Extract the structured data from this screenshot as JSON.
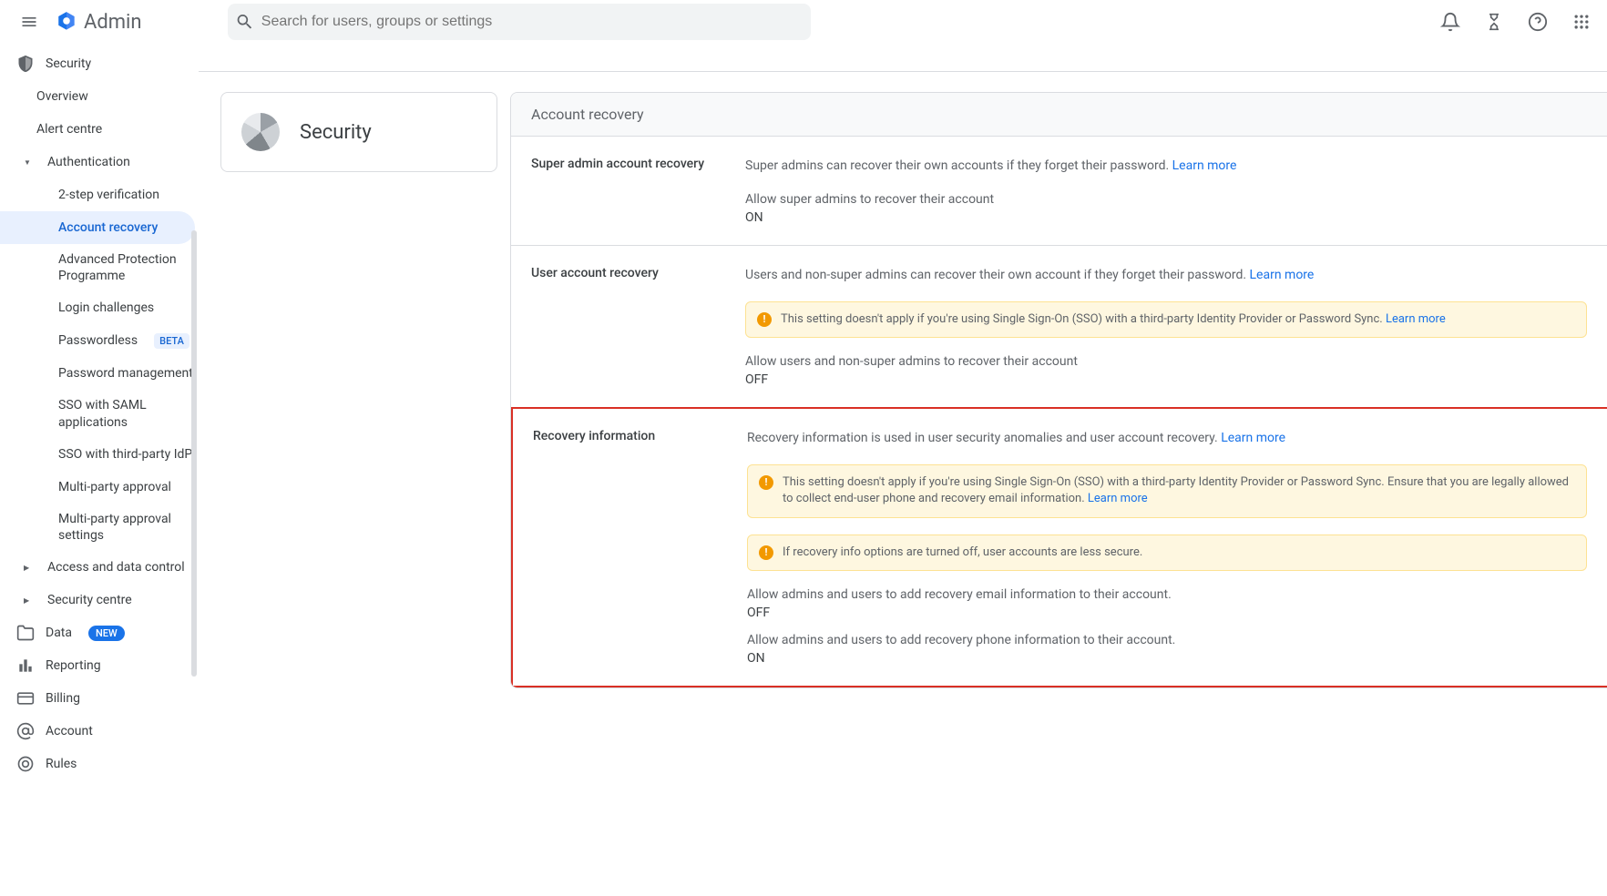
{
  "header": {
    "brand": "Admin",
    "search_placeholder": "Search for users, groups or settings"
  },
  "sidebar": {
    "security": "Security",
    "overview": "Overview",
    "alert_centre": "Alert centre",
    "authentication": "Authentication",
    "auth_items": {
      "two_step": "2-step verification",
      "account_recovery": "Account recovery",
      "app": "Advanced Protection Programme",
      "login_challenges": "Login challenges",
      "passwordless": "Passwordless",
      "beta_badge": "BETA",
      "password_mgmt": "Password management",
      "sso_saml": "SSO with SAML applications",
      "sso_third": "SSO with third-party IdP",
      "multi_party": "Multi-party approval",
      "multi_party_settings": "Multi-party approval settings"
    },
    "access_data": "Access and data control",
    "security_centre": "Security centre",
    "data": "Data",
    "new_badge": "NEW",
    "reporting": "Reporting",
    "billing": "Billing",
    "account": "Account",
    "rules": "Rules"
  },
  "page": {
    "title": "Security"
  },
  "card": {
    "header": "Account recovery",
    "rows": {
      "super_admin": {
        "label": "Super admin account recovery",
        "desc": "Super admins can recover their own accounts if they forget their password. ",
        "learn_more": "Learn more",
        "sub": "Allow super admins to recover their account",
        "val": "ON"
      },
      "user_recovery": {
        "label": "User account recovery",
        "desc": "Users and non-super admins can recover their own account if they forget their password. ",
        "learn_more": "Learn more",
        "warn": "This setting doesn't apply if you're using Single Sign-On (SSO) with a third-party Identity Provider or Password Sync. ",
        "warn_link": "Learn more",
        "sub": "Allow users and non-super admins to recover their account",
        "val": "OFF"
      },
      "recovery_info": {
        "label": "Recovery information",
        "desc": "Recovery information is used in user security anomalies and user account recovery. ",
        "learn_more": "Learn more",
        "warn1": "This setting doesn't apply if you're using Single Sign-On (SSO) with a third-party Identity Provider or Password Sync. Ensure that you are legally allowed to collect end-user phone and recovery email information. ",
        "warn1_link": "Learn more",
        "warn2": "If recovery info options are turned off, user accounts are less secure.",
        "sub1": "Allow admins and users to add recovery email information to their account.",
        "val1": "OFF",
        "sub2": "Allow admins and users to add recovery phone information to their account.",
        "val2": "ON"
      }
    }
  }
}
